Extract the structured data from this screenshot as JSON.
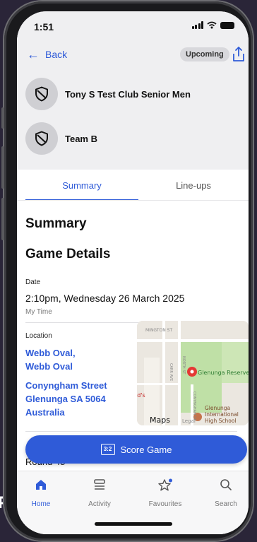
{
  "status": {
    "time": "1:51"
  },
  "header": {
    "back_label": "Back",
    "status_badge": "Upcoming"
  },
  "teams": [
    {
      "name": "Tony S Test Club Senior Men"
    },
    {
      "name": "Team B"
    }
  ],
  "tabs": [
    {
      "label": "Summary",
      "active": true
    },
    {
      "label": "Line-ups",
      "active": false
    }
  ],
  "summary": {
    "heading": "Summary",
    "game_details_heading": "Game Details",
    "date_label": "Date",
    "date_value": "2:10pm, Wednesday 26 March 2025",
    "time_note": "My Time",
    "location_label": "Location",
    "venue_line1": "Webb Oval,",
    "venue_line2": "Webb Oval",
    "address_line1": "Conyngham Street",
    "address_line2": "Glenunga SA 5064",
    "address_line3": "Australia",
    "round_text": "Round 48"
  },
  "map": {
    "labels": {
      "street_top": "MINGTON ST",
      "north_st": "NORTH ST",
      "carr_ave": "CARR AVE",
      "conyngham": "CONYNGHAM ST",
      "reserve": "Glenunga Reserve",
      "school_line1": "Glenunga",
      "school_line2": "International",
      "school_line3": "High School",
      "mcds": "ld's",
      "brand": "Maps",
      "legal": "Legal"
    }
  },
  "actions": {
    "score_game": "Score Game",
    "score_icon_text": "3:2"
  },
  "tabbar": {
    "items": [
      {
        "label": "Home",
        "icon": "home-icon",
        "active": true
      },
      {
        "label": "Activity",
        "icon": "activity-icon",
        "active": false
      },
      {
        "label": "Favourites",
        "icon": "star-icon",
        "active": false
      },
      {
        "label": "Search",
        "icon": "search-icon",
        "active": false
      }
    ]
  },
  "colors": {
    "accent": "#2f5bd8",
    "header_bg": "#efeff1"
  }
}
